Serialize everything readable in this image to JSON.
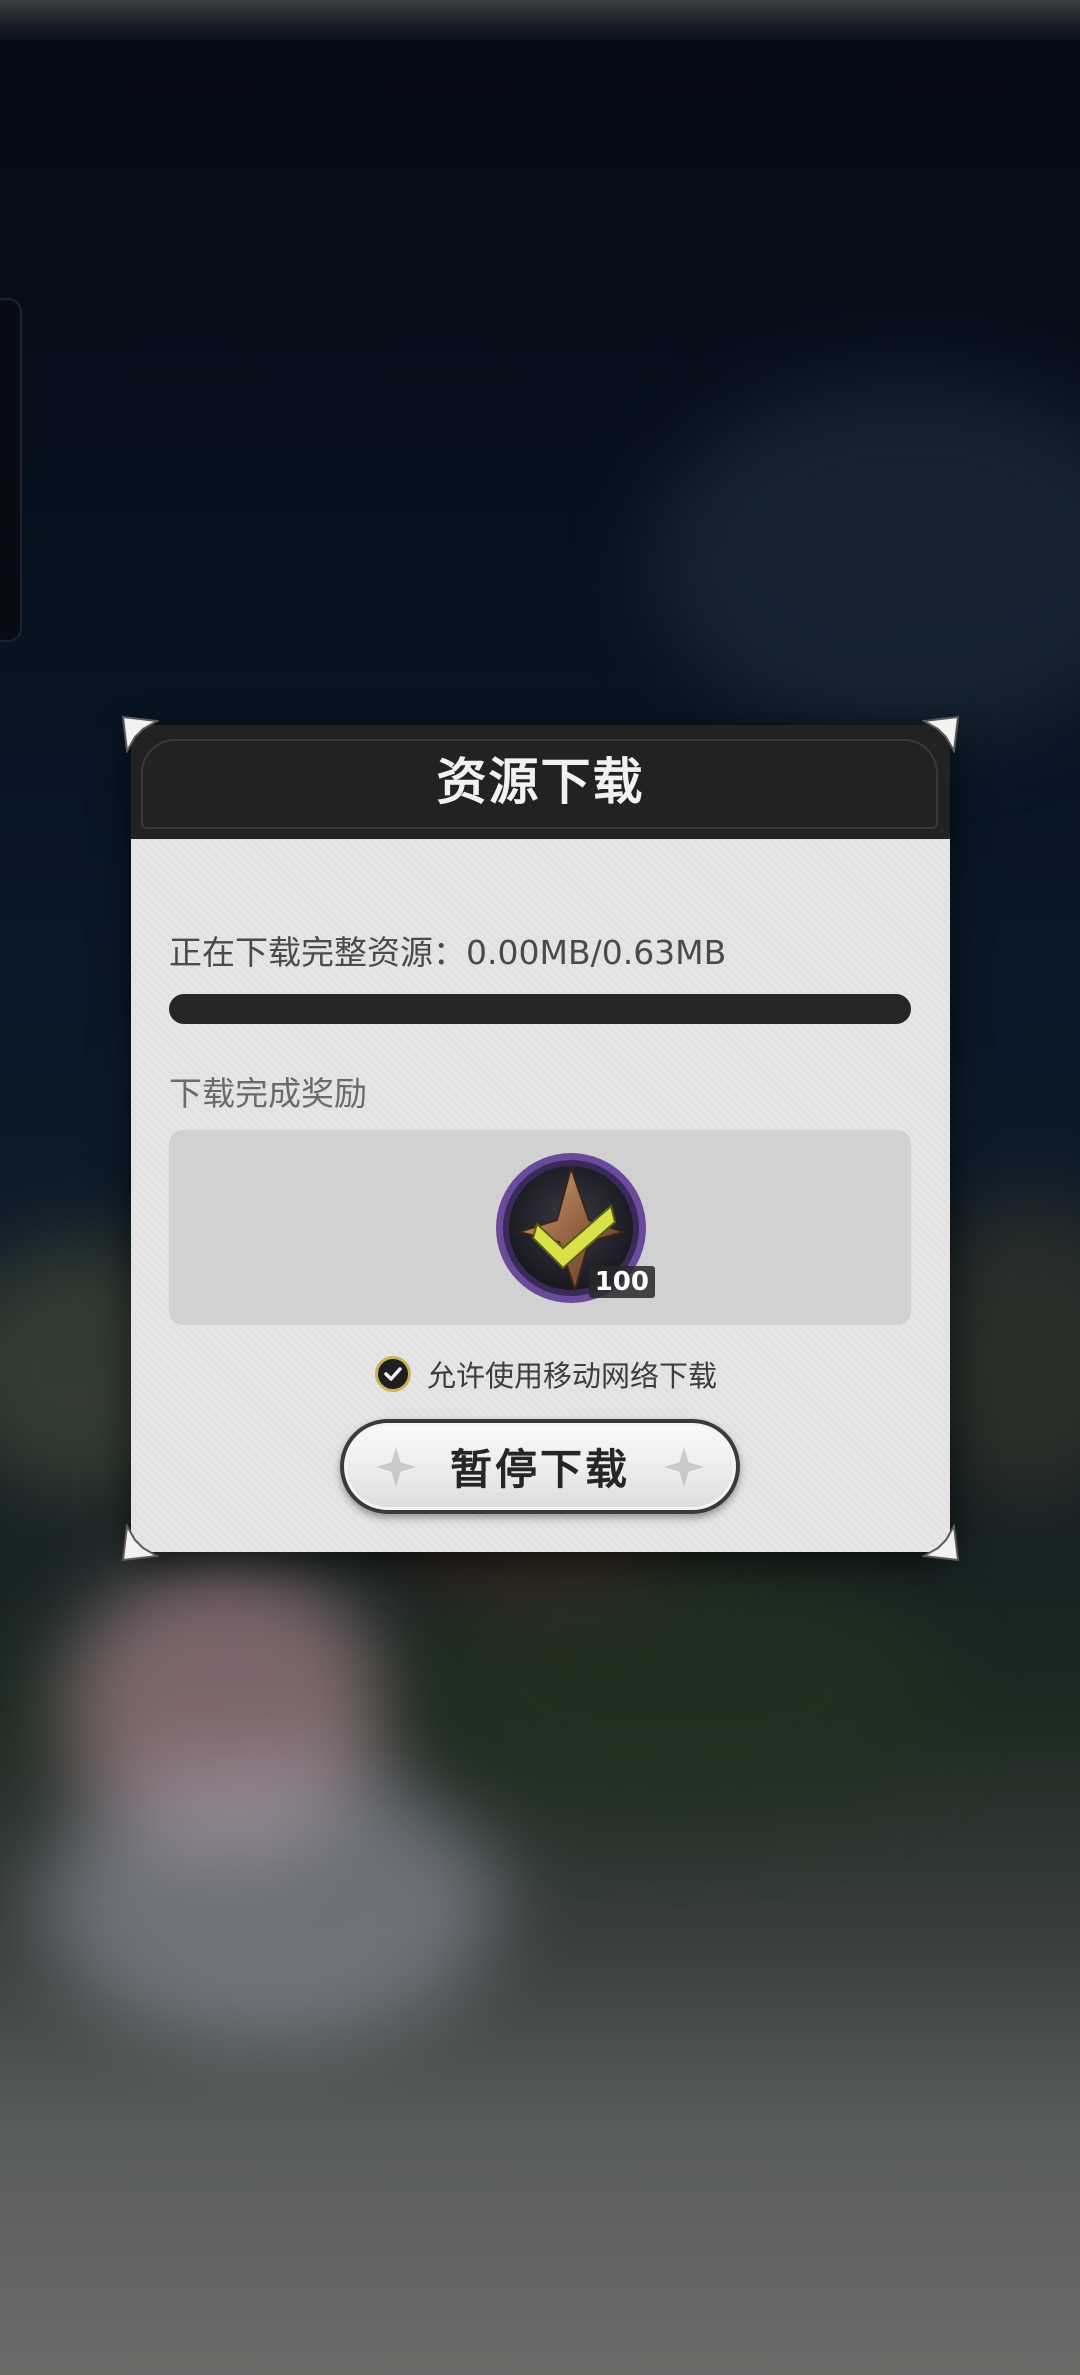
{
  "dialog": {
    "title": "资源下载",
    "status_text": "正在下载完整资源：0.00MB/0.63MB",
    "downloaded_mb": 0.0,
    "total_mb": 0.63,
    "progress_fraction": 0.0,
    "reward_label": "下载完成奖励",
    "reward": {
      "icon": "crystal-shard-icon",
      "count": "100"
    },
    "mobile_network": {
      "label": "允许使用移动网络下载",
      "checked": true
    },
    "pause_button_label": "暂停下载"
  },
  "colors": {
    "header_bg": "#222222",
    "body_bg": "#e5e5e5",
    "progress_track": "#262626",
    "reward_frame": "#5a3f8a"
  }
}
